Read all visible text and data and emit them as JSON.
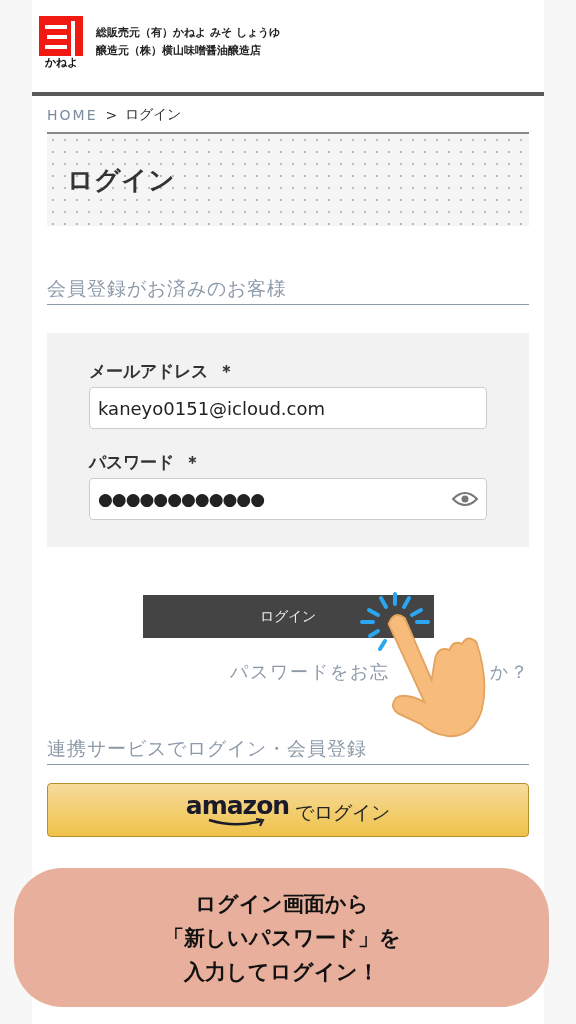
{
  "header": {
    "logo_text": "かねよ",
    "lines": [
      "総販売元（有）かねよ みそ しょうゆ",
      "醸造元（株）横山味噌醤油醸造店"
    ]
  },
  "breadcrumb": [
    {
      "label": "HOME",
      "kind": "link"
    },
    {
      "label": ">",
      "kind": "separator"
    },
    {
      "label": "ログイン",
      "kind": "current"
    }
  ],
  "page_title": "ログイン",
  "member_section": {
    "heading": "会員登録がお済みのお客様",
    "fields": [
      {
        "label": "メールアドレス",
        "required_mark": "＊",
        "value": "kaneyo0151@icloud.com",
        "kind": "text"
      },
      {
        "label": "パスワード",
        "required_mark": "＊",
        "value": "●●●●●●●●●●●●",
        "kind": "password"
      }
    ],
    "login_button": "ログイン",
    "forgot_link": {
      "text_before": "パスワードをお忘",
      "text_after": "か？"
    }
  },
  "social_section": {
    "heading": "連携サービスでログイン・会員登録",
    "amazon_button": {
      "logo": "amazon",
      "label": "でログイン"
    }
  },
  "caption": [
    "ログイン画面から",
    "「新しいパスワード」を",
    "入力してログイン！"
  ]
}
